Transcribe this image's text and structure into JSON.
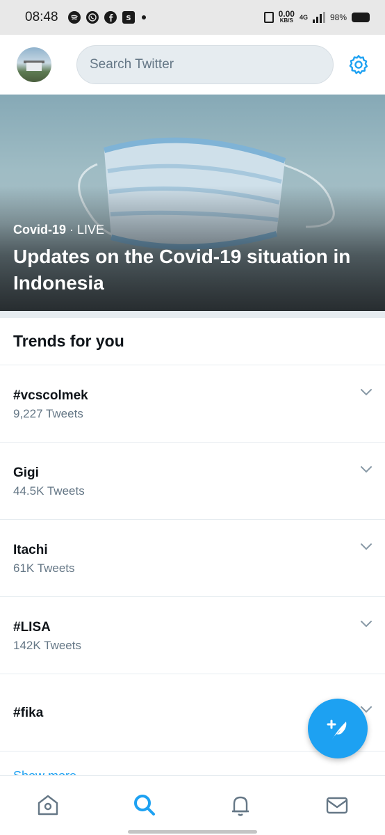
{
  "status_bar": {
    "time": "08:48",
    "apps": [
      "spotify-icon",
      "whatsapp-icon",
      "facebook-icon",
      "shopee-icon"
    ],
    "speed_value": "0.00",
    "speed_unit": "KB/S",
    "network": "4G",
    "battery": "98%"
  },
  "header": {
    "search_placeholder": "Search Twitter"
  },
  "banner": {
    "category": "Covid-19",
    "live": "LIVE",
    "separator": " · ",
    "title": "Updates on the Covid-19 situation in Indonesia"
  },
  "trends": {
    "heading": "Trends for you",
    "items": [
      {
        "name": "#vcscolmek",
        "count": "9,227 Tweets"
      },
      {
        "name": "Gigi",
        "count": "44.5K Tweets"
      },
      {
        "name": "Itachi",
        "count": "61K Tweets"
      },
      {
        "name": "#LISA",
        "count": "142K Tweets"
      },
      {
        "name": "#fika",
        "count": ""
      }
    ],
    "show_more": "Show more"
  },
  "nav": [
    "home-icon",
    "search-icon",
    "notifications-icon",
    "messages-icon"
  ],
  "colors": {
    "accent": "#1da1f2",
    "secondary_text": "#657786",
    "divider": "#e6ecf0"
  }
}
